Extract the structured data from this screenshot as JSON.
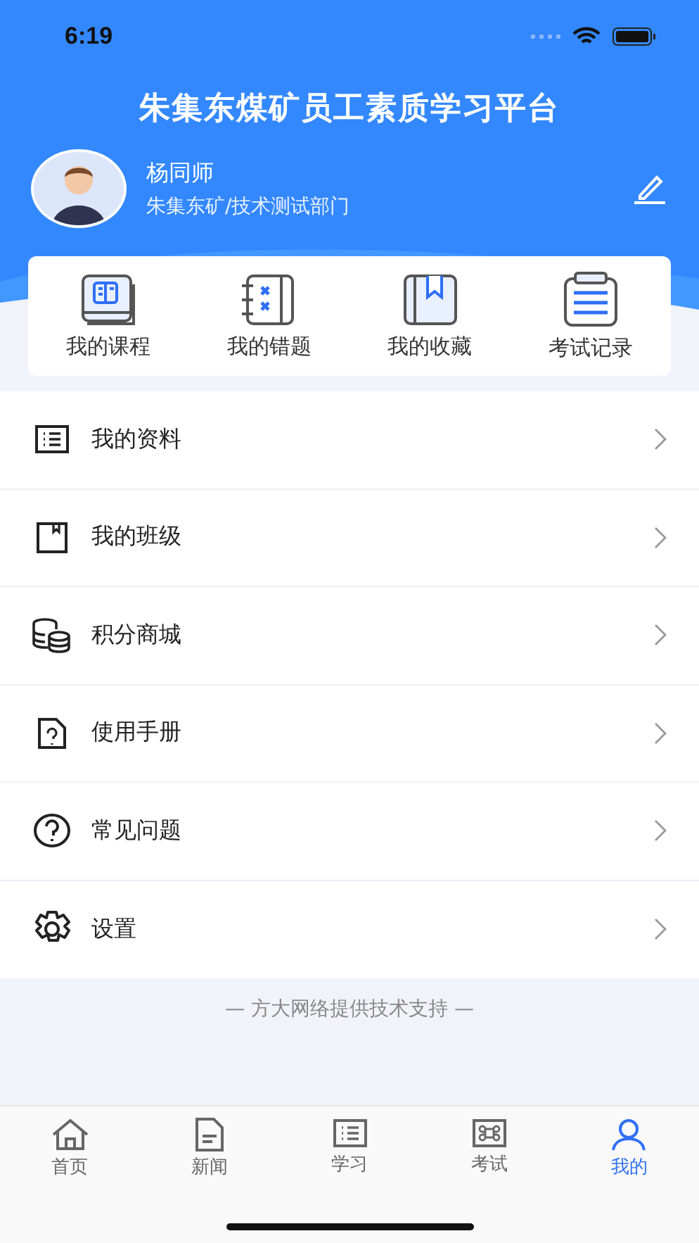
{
  "status_bar": {
    "time": "6:19"
  },
  "header": {
    "title": "朱集东煤矿员工素质学习平台"
  },
  "profile": {
    "name": "杨同师",
    "department": "朱集东矿/技术测试部门"
  },
  "shortcuts": [
    {
      "label": "我的课程",
      "kind": "book"
    },
    {
      "label": "我的错题",
      "kind": "notebook"
    },
    {
      "label": "我的收藏",
      "kind": "bookmark"
    },
    {
      "label": "考试记录",
      "kind": "clipboard"
    }
  ],
  "menu": [
    {
      "label": "我的资料",
      "kind": "list"
    },
    {
      "label": "我的班级",
      "kind": "class"
    },
    {
      "label": "积分商城",
      "kind": "coins"
    },
    {
      "label": "使用手册",
      "kind": "manual"
    },
    {
      "label": "常见问题",
      "kind": "question"
    },
    {
      "label": "设置",
      "kind": "settings"
    }
  ],
  "footer": "— 方大网络提供技术支持 —",
  "tab_bar": [
    {
      "label": "首页",
      "kind": "home",
      "selected": false
    },
    {
      "label": "新闻",
      "kind": "news",
      "selected": false
    },
    {
      "label": "学习",
      "kind": "study",
      "selected": false
    },
    {
      "label": "考试",
      "kind": "exam",
      "selected": false
    },
    {
      "label": "我的",
      "kind": "me",
      "selected": true
    }
  ]
}
